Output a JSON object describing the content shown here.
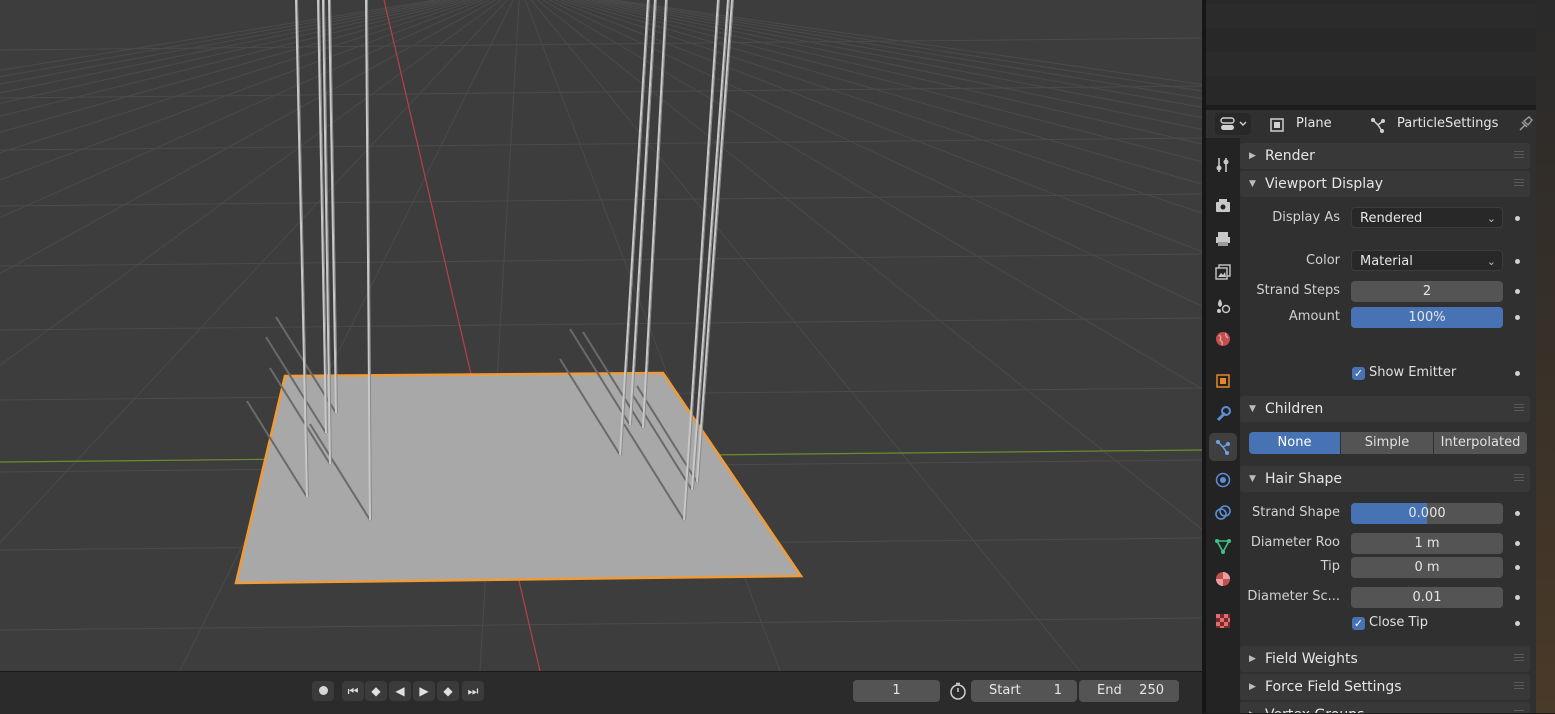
{
  "viewport": {
    "colors": {
      "background": "#3d3d3d",
      "grid": "#4a4a4a",
      "x_axis": "#b6414a",
      "y_axis": "#6c8d2c",
      "plane": "#aaaaaa",
      "selection": "#f29b36"
    }
  },
  "timeline": {
    "current_frame": "1",
    "start_label": "Start",
    "start_value": "1",
    "end_label": "End",
    "end_value": "250",
    "buttons": [
      "record",
      "jump-start",
      "prev-keyframe",
      "play-reverse",
      "play",
      "next-keyframe",
      "jump-end"
    ]
  },
  "header": {
    "object_name": "Plane",
    "settings_name": "ParticleSettings"
  },
  "sidebar_tabs": [
    "tool",
    "render",
    "output",
    "view-layer",
    "scene",
    "world",
    "object",
    "modifiers",
    "particles",
    "physics",
    "constraints",
    "data",
    "material",
    "texture"
  ],
  "panels": {
    "render": {
      "title": "Render"
    },
    "viewport_display": {
      "title": "Viewport Display",
      "display_as_label": "Display As",
      "display_as_value": "Rendered",
      "color_label": "Color",
      "color_value": "Material",
      "strand_steps_label": "Strand Steps",
      "strand_steps_value": "2",
      "amount_label": "Amount",
      "amount_value": "100%",
      "amount_fraction": 1.0,
      "show_emitter_label": "Show Emitter",
      "show_emitter_checked": true
    },
    "children": {
      "title": "Children",
      "options": [
        "None",
        "Simple",
        "Interpolated"
      ],
      "selected": "None"
    },
    "hair_shape": {
      "title": "Hair Shape",
      "strand_shape_label": "Strand Shape",
      "strand_shape_value": "0.000",
      "strand_shape_fraction": 0.5,
      "diameter_root_label": "Diameter Roo",
      "diameter_root_value": "1 m",
      "tip_label": "Tip",
      "tip_value": "0 m",
      "diameter_scale_label": "Diameter Sc...",
      "diameter_scale_value": "0.01",
      "close_tip_label": "Close Tip",
      "close_tip_checked": true
    },
    "field_weights": {
      "title": "Field Weights"
    },
    "force_field_settings": {
      "title": "Force Field Settings"
    },
    "vertex_groups": {
      "title": "Vertex Groups"
    }
  },
  "accent_color": "#4772b3"
}
